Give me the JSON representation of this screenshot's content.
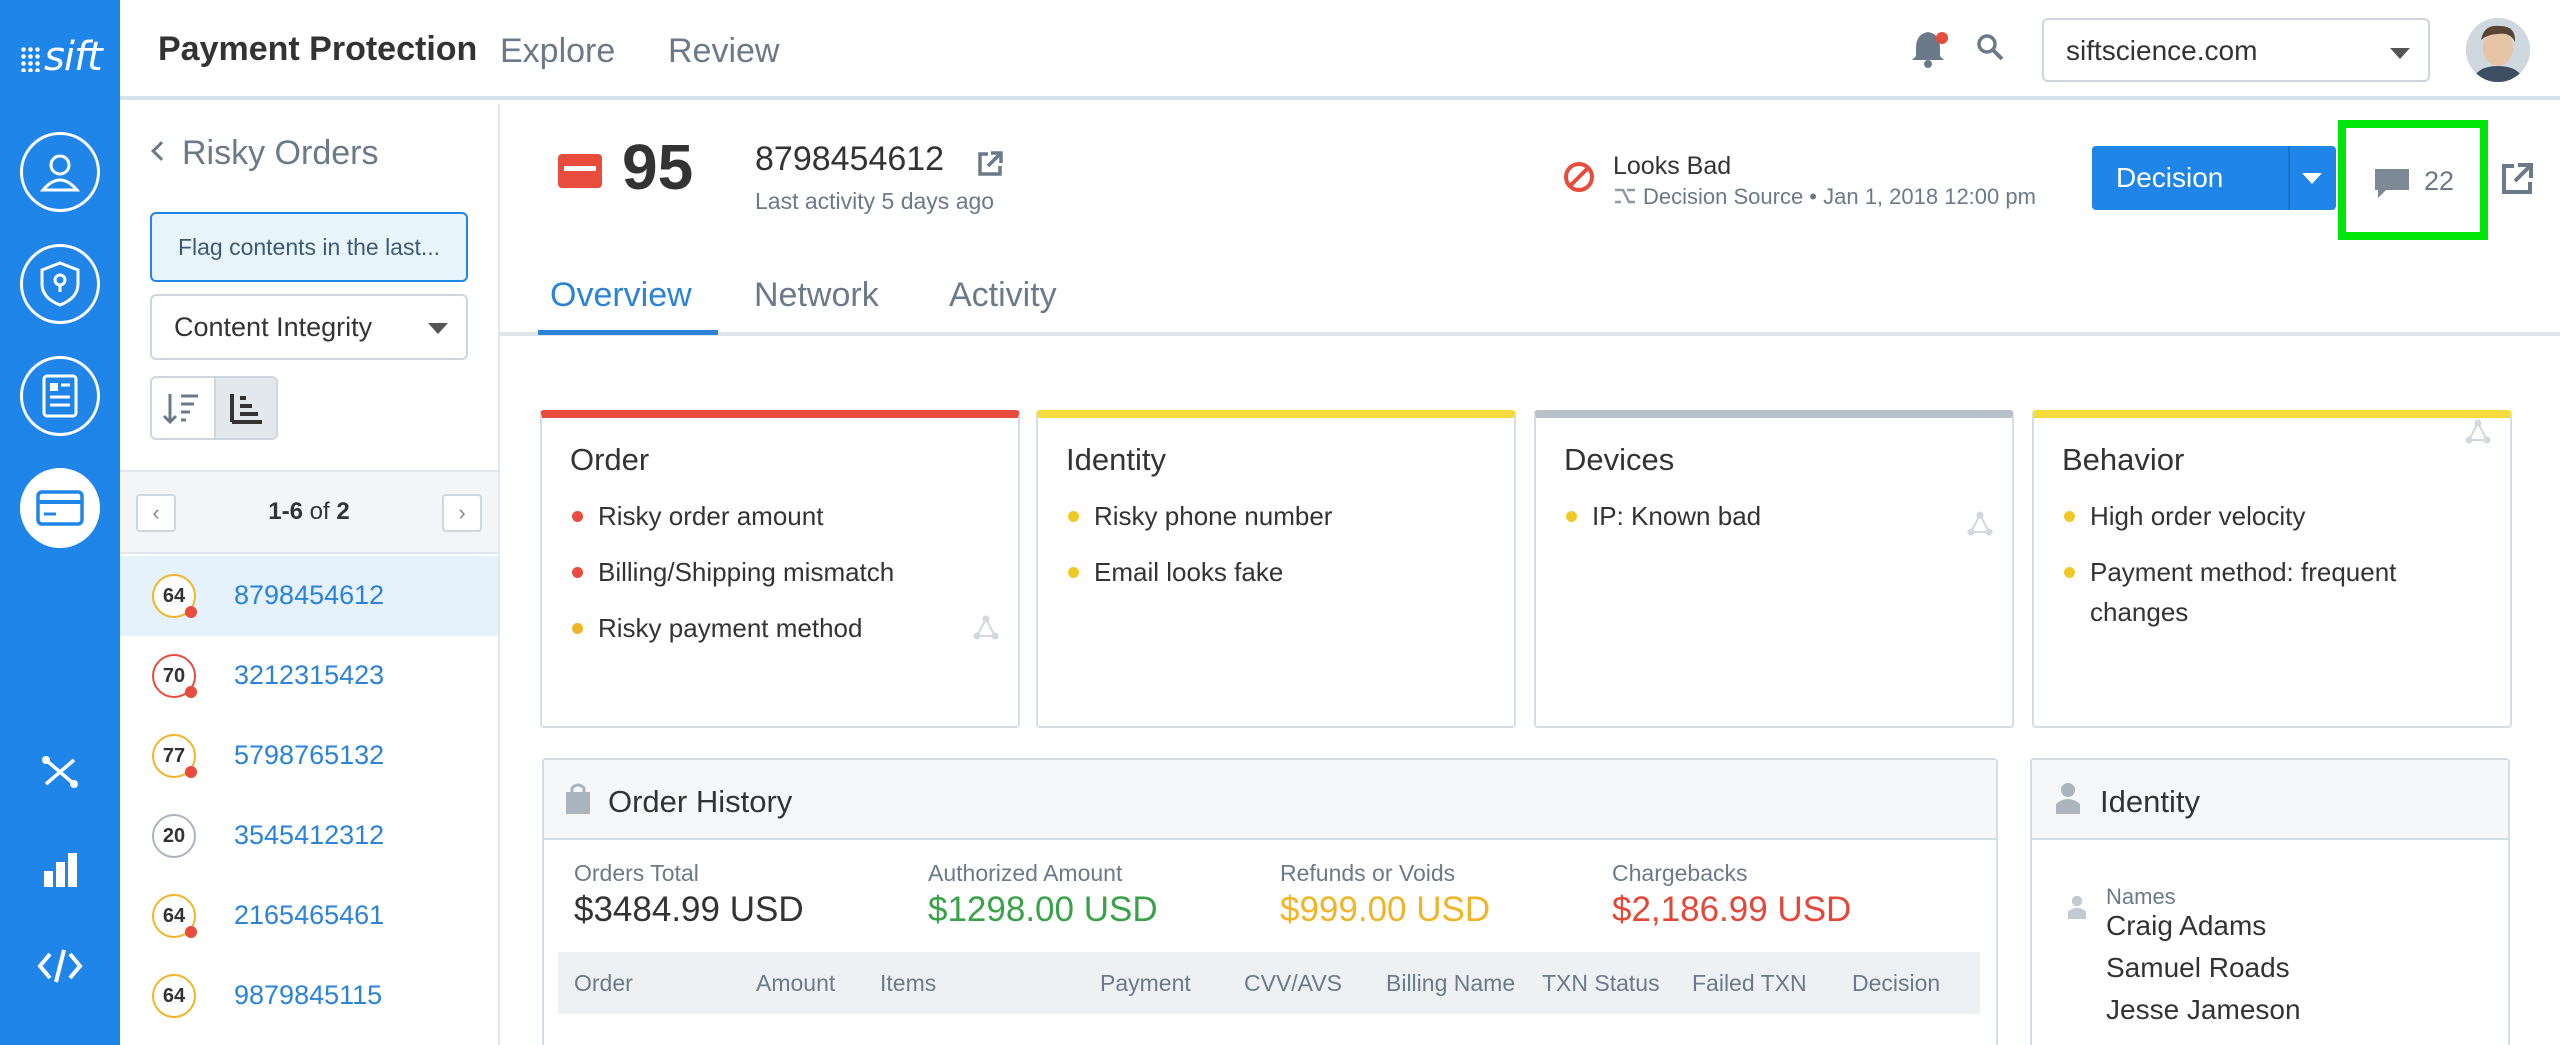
{
  "rail": {
    "logo": "sift",
    "buttons": [
      "user-icon",
      "shield-icon",
      "document-icon",
      "credit-card-icon"
    ],
    "icons": [
      "workflow-icon",
      "bar-chart-icon",
      "code-icon"
    ]
  },
  "header": {
    "title": "Payment Protection",
    "nav": [
      "Explore",
      "Review"
    ],
    "domain": "siftscience.com"
  },
  "list": {
    "back_label": "Risky Orders",
    "flag_button": "Flag contents in the last...",
    "filter": "Content Integrity",
    "pager": {
      "range": "1-6",
      "of": "of",
      "total": "2"
    },
    "orders": [
      {
        "score": "64",
        "id": "8798454612",
        "ring": "#f0b429",
        "dot": true
      },
      {
        "score": "70",
        "id": "3212315423",
        "ring": "#e84c3d",
        "dot": true
      },
      {
        "score": "77",
        "id": "5798765132",
        "ring": "#f0b429",
        "dot": true
      },
      {
        "score": "20",
        "id": "3545412312",
        "ring": "#aab4bd",
        "dot": false
      },
      {
        "score": "64",
        "id": "2165465461",
        "ring": "#f0b429",
        "dot": true
      },
      {
        "score": "64",
        "id": "9879845115",
        "ring": "#f0b429",
        "dot": false
      }
    ]
  },
  "detail": {
    "score": "95",
    "order_id": "8798454612",
    "last_activity": "Last activity 5 days ago",
    "status": "Looks Bad",
    "decision_source": "Decision Source • Jan 1, 2018 12:00 pm",
    "decision_button": "Decision",
    "comment_count": "22",
    "tabs": [
      "Overview",
      "Network",
      "Activity"
    ]
  },
  "signals": [
    {
      "title": "Order",
      "color": "#e84c3d",
      "items": [
        {
          "text": "Risky order amount",
          "color": "#e84c3d"
        },
        {
          "text": "Billing/Shipping mismatch",
          "color": "#e84c3d"
        },
        {
          "text": "Risky payment method",
          "color": "#f0b429"
        }
      ]
    },
    {
      "title": "Identity",
      "color": "#f5dc3c",
      "items": [
        {
          "text": "Risky phone number",
          "color": "#f0c929"
        },
        {
          "text": "Email looks fake",
          "color": "#f0c929"
        }
      ]
    },
    {
      "title": "Devices",
      "color": "#b7c1ca",
      "items": [
        {
          "text": "IP: Known bad",
          "color": "#f0c929"
        }
      ]
    },
    {
      "title": "Behavior",
      "color": "#f5dc3c",
      "items": [
        {
          "text": "High order velocity",
          "color": "#f0c929"
        },
        {
          "text": "Payment method: frequent changes",
          "color": "#f0c929"
        }
      ]
    }
  ],
  "order_history": {
    "title": "Order History",
    "stats": [
      {
        "label": "Orders Total",
        "value": "$3484.99 USD",
        "color": "#333333"
      },
      {
        "label": "Authorized Amount",
        "value": "$1298.00 USD",
        "color": "#3aa14a"
      },
      {
        "label": "Refunds or Voids",
        "value": "$999.00 USD",
        "color": "#f0b429"
      },
      {
        "label": "Chargebacks",
        "value": "$2,186.99 USD",
        "color": "#e0493a"
      }
    ],
    "columns": [
      "Order",
      "Amount",
      "Items",
      "Payment",
      "CVV/AVS",
      "Billing Name",
      "TXN Status",
      "Failed TXN",
      "Decision"
    ]
  },
  "identity": {
    "title": "Identity",
    "names_label": "Names",
    "names": [
      "Craig Adams",
      "Samuel Roads",
      "Jesse Jameson"
    ]
  }
}
